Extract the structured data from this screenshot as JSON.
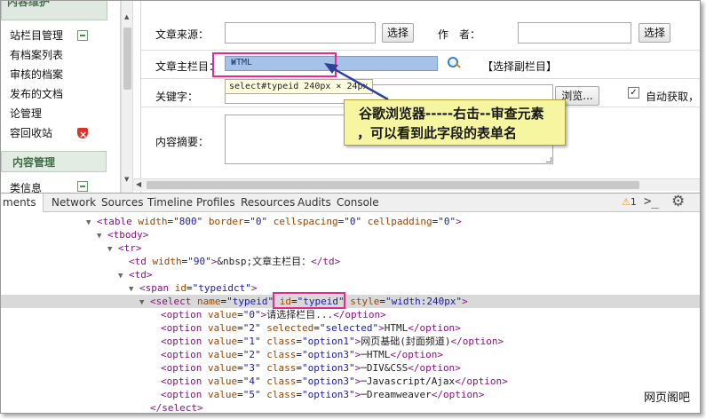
{
  "left_panel": {
    "header": "内容维护",
    "items": [
      "站栏目管理",
      "有档案列表",
      "审核的档案",
      "发布的文档",
      "论管理",
      "容回收站"
    ],
    "section": "内容管理",
    "last_item": "类信息"
  },
  "form": {
    "source_label": "文章来源：",
    "source_button": "选择",
    "author_label": "作　者：",
    "author_button": "选择",
    "column_label": "文章主栏目：",
    "column_selected": "HTML",
    "sub_column_link": "【选择副栏目】",
    "tooltip": "select#typeid 240px × 24px",
    "keyword_label": "关键字：",
    "browse_button": "浏览...",
    "auto_get_label": "自动获取，",
    "summary_label": "内容摘要："
  },
  "callout": {
    "line1": "谷歌浏览器-----右击--审查元素",
    "line2": "，可以看到此字段的表单名"
  },
  "devtools": {
    "tabs": [
      "ments",
      "Network",
      "Sources",
      "Timeline",
      "Profiles",
      "Resources",
      "Audits",
      "Console"
    ],
    "warning_count": "1",
    "code_lines": [
      {
        "indent": 96,
        "tri": "▼",
        "html": "<table width=\"800\" border=\"0\" cellspacing=\"0\" cellpadding=\"0\">"
      },
      {
        "indent": 108,
        "tri": "▼",
        "html": "<tbody>"
      },
      {
        "indent": 120,
        "tri": "▼",
        "html": "<tr>"
      },
      {
        "indent": 144,
        "tri": "",
        "html": "<td width=\"90\">&amp;nbsp;文章主栏目：</td>"
      },
      {
        "indent": 132,
        "tri": "▼",
        "html": "<td>"
      },
      {
        "indent": 144,
        "tri": "▼",
        "html": "<span id=\"typeidct\">"
      },
      {
        "indent": 156,
        "tri": "▼",
        "html": "<select name=\"typeid\" id=\"typeid\" style=\"width:240px\">"
      },
      {
        "indent": 180,
        "tri": "",
        "html": "<option value=\"0\">请选择栏目...</option>"
      },
      {
        "indent": 180,
        "tri": "",
        "html": "<option value=\"2\" selected=\"selected\">HTML</option>"
      },
      {
        "indent": 180,
        "tri": "",
        "html": "<option value=\"1\" class=\"option1\">网页基础(封面频道)</option>"
      },
      {
        "indent": 180,
        "tri": "",
        "html": "<option value=\"2\" class=\"option3\">─HTML</option>"
      },
      {
        "indent": 180,
        "tri": "",
        "html": "<option value=\"3\" class=\"option3\">─DIV&amp;CSS</option>"
      },
      {
        "indent": 180,
        "tri": "",
        "html": "<option value=\"4\" class=\"option3\">─Javascript/Ajax</option>"
      },
      {
        "indent": 180,
        "tri": "",
        "html": "<option value=\"5\" class=\"option3\">─Dreamweaver</option>"
      },
      {
        "indent": 168,
        "tri": "",
        "html": "</select>"
      }
    ]
  },
  "watermark": "网页阁吧",
  "colors": {
    "highlight_pink": "#e6288f",
    "callout_bg": "#f7f6a0",
    "select_bg": "#a7c2e9",
    "arrow_blue": "#2f3f9a"
  }
}
